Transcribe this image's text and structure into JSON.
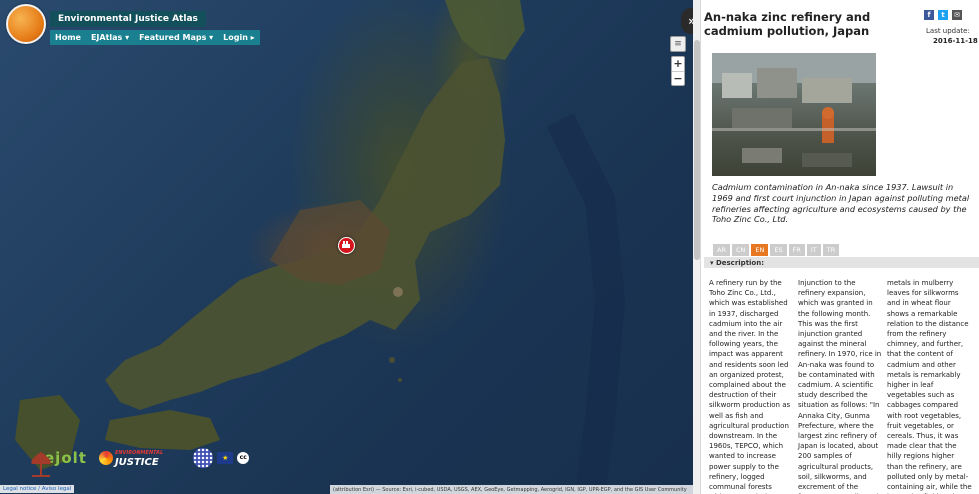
{
  "app": {
    "title": "Environmental Justice Atlas",
    "nav": [
      "Home",
      "EJAtlas ▾",
      "Featured Maps ▾",
      "Login ▸"
    ]
  },
  "map": {
    "controls": {
      "zoom_in": "+",
      "zoom_out": "−",
      "toggle": "»"
    },
    "legal_notice": "Legal notice / Aviso legal",
    "attribution": "(attribution Esri) — Source: Esri, i-cubed, USDA, USGS, AEX, GeoEye, Getmapping, Aerogrid, IGN, IGP, UPR-EGP, and the GIS User Community",
    "logos": {
      "ejolt": "ejolt",
      "ej_top": "ENVIRONMENTAL",
      "ej_bottom": "JUSTICE",
      "eu": "★",
      "cc": "cc"
    },
    "marker_icon": "factory-icon"
  },
  "panel": {
    "title": "An-naka zinc refinery and cadmium pollution, Japan",
    "last_update_label": "Last update:",
    "last_update": "2016-11-18",
    "share": {
      "facebook": "f",
      "twitter": "t",
      "email": "✉"
    },
    "summary": "Cadmium contamination in An-naka since 1937. Lawsuit in 1969 and first court injunction in Japan against polluting metal refineries affecting agriculture and ecosystems caused by the Toho Zinc Co., Ltd.",
    "languages": [
      "AR",
      "CN",
      "EN",
      "ES",
      "FR",
      "IT",
      "TR"
    ],
    "active_language": "EN",
    "description_label": "Description:",
    "description_columns": [
      "A refinery run by the Toho Zinc Co., Ltd., which was established in 1937, discharged cadmium into the air and the river. In the following years, the impact was apparent and residents soon led an organized protest, complained about the destruction of their silkworm production as well as fish and agricultural production downstream. In the 1960s, TEPCO, which wanted to increase power supply to the refinery, logged communal forests without permission.",
      "Injunction to the refinery expansion, which was granted in the following month. This was the first injunction granted against the mineral refinery. In 1970, rice in An-naka was found to be contaminated with cadmium. A scientific study described the situation as follows: \"In Annaka City, Gunma Prefecture, where the largest zinc refinery of Japan is located, about 200 samples of agricultural products, soil, silkworms, and excrement of the farmers were collected",
      "metals in mulberry leaves for silkworms and in wheat flour shows a remarkable relation to the distance from the refinery chimney, and further, that the content of cadmium and other metals is remarkably higher in leaf vegetables such as cabbages compared with root vegetables, fruit vegetables, or cereals. Thus, it was made clear that the hilly regions higher than the refinery, are polluted only by metal-containing air, while the lower rice field regions are affected by"
    ]
  }
}
